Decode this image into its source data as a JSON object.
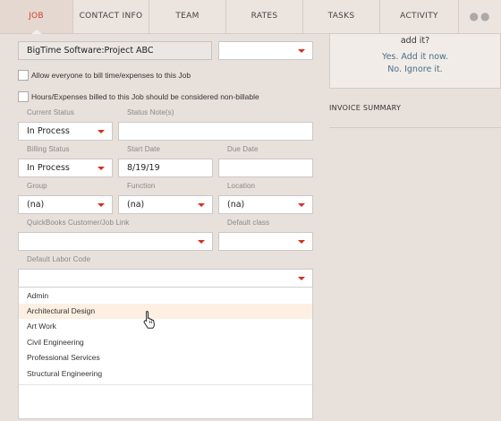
{
  "tabs": [
    {
      "label": "JOB",
      "active": true
    },
    {
      "label": "CONTACT INFO"
    },
    {
      "label": "TEAM"
    },
    {
      "label": "RATES"
    },
    {
      "label": "TASKS"
    },
    {
      "label": "ACTIVITY"
    }
  ],
  "more_icon": "more-dots-icon",
  "project": {
    "value": "BigTime Software:Project ABC"
  },
  "checkboxes": {
    "allow_bill": "Allow everyone to bill time/expenses to this Job",
    "non_billable": "Hours/Expenses billed to this Job should be considered non-billable"
  },
  "fields": {
    "current_status_label": "Current Status",
    "current_status_value": "In Process",
    "status_notes_label": "Status Note(s)",
    "billing_status_label": "Billing Status",
    "billing_status_value": "In Process",
    "start_date_label": "Start Date",
    "start_date_value": "8/19/19",
    "due_date_label": "Due Date",
    "group_label": "Group",
    "group_value": "(na)",
    "function_label": "Function",
    "function_value": "(na)",
    "location_label": "Location",
    "location_value": "(na)",
    "qb_label": "QuickBooks Customer/Job Link",
    "default_class_label": "Default class",
    "labor_code_label": "Default Labor Code"
  },
  "labor_codes": [
    "Admin",
    "Architectural Design",
    "Art Work",
    "Civil Engineering",
    "Professional Services",
    "Structural Engineering"
  ],
  "hovered_index": 1,
  "side_panel": {
    "question": "add it?",
    "yes": "Yes. Add it now.",
    "no": "No. Ignore it."
  },
  "invoice_summary_title": "INVOICE SUMMARY",
  "colors": {
    "accent": "#d32f1f",
    "link": "#4a6f8a",
    "background": "#e8e0db"
  }
}
